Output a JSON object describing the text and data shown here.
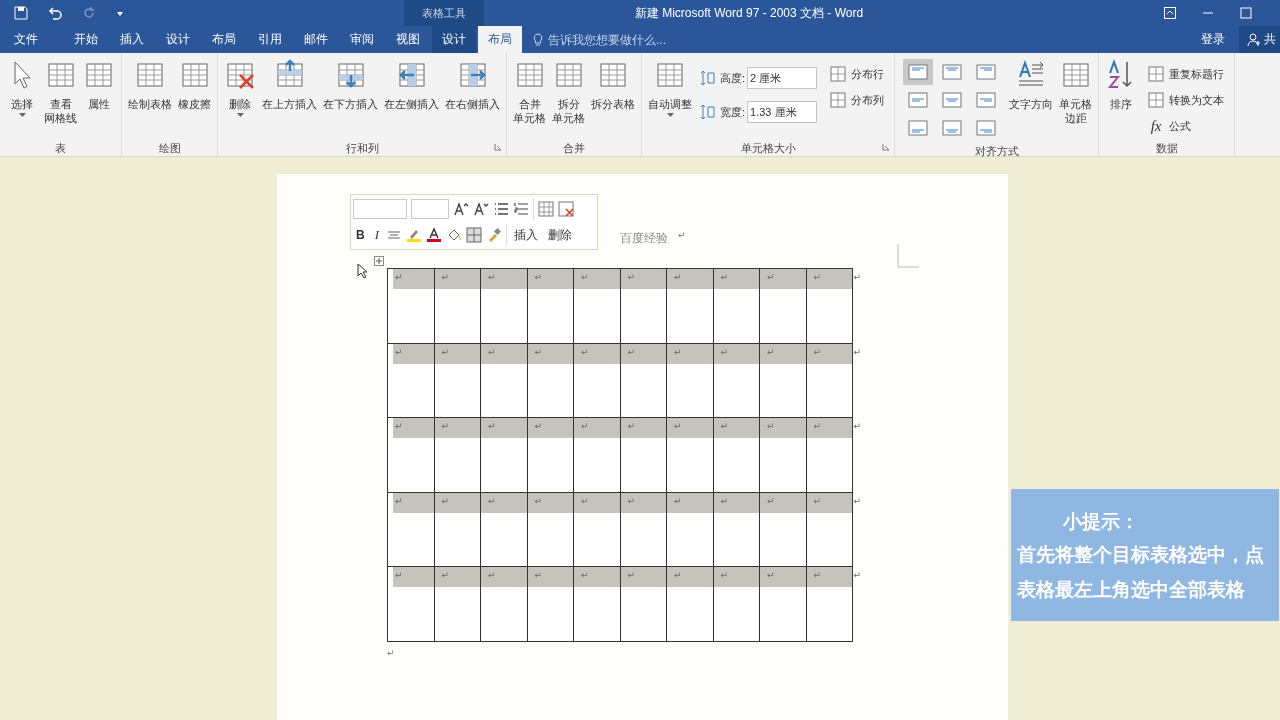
{
  "title_bar": {
    "context_label": "表格工具",
    "title": "新建 Microsoft Word 97 - 2003 文档 - Word"
  },
  "tabs": [
    {
      "label": "文件",
      "kind": "main",
      "selected": false
    },
    {
      "label": "开始",
      "kind": "main",
      "selected": false
    },
    {
      "label": "插入",
      "kind": "main",
      "selected": false
    },
    {
      "label": "设计",
      "kind": "main",
      "selected": false
    },
    {
      "label": "布局",
      "kind": "main",
      "selected": false
    },
    {
      "label": "引用",
      "kind": "main",
      "selected": false
    },
    {
      "label": "邮件",
      "kind": "main",
      "selected": false
    },
    {
      "label": "审阅",
      "kind": "main",
      "selected": false
    },
    {
      "label": "视图",
      "kind": "main",
      "selected": false
    },
    {
      "label": "设计",
      "kind": "context",
      "selected": false
    },
    {
      "label": "布局",
      "kind": "context",
      "selected": true
    }
  ],
  "tell_me": {
    "placeholder": "告诉我您想要做什么..."
  },
  "account": {
    "sign_in": "登录",
    "share": "共"
  },
  "ribbon": [
    {
      "label": "表",
      "launcher": false,
      "items": [
        {
          "kind": "pointer",
          "label": "选择",
          "caret": true
        },
        {
          "kind": "table",
          "lines": [
            "查看",
            "网格线"
          ],
          "caret": false
        },
        {
          "kind": "table",
          "label": "属性",
          "caret": false
        }
      ]
    },
    {
      "label": "绘图",
      "launcher": false,
      "items": [
        {
          "kind": "table",
          "label": "绘制表格",
          "caret": false
        },
        {
          "kind": "table",
          "label": "橡皮擦",
          "caret": false
        }
      ]
    },
    {
      "label": "行和列",
      "launcher": true,
      "items": [
        {
          "kind": "delete",
          "label": "删除",
          "caret": true
        },
        {
          "kind": "above",
          "label": "在上方插入",
          "caret": false
        },
        {
          "kind": "below",
          "label": "在下方插入",
          "caret": false
        },
        {
          "kind": "left",
          "label": "在左侧插入",
          "caret": false
        },
        {
          "kind": "right",
          "label": "在右侧插入",
          "caret": false
        }
      ]
    },
    {
      "label": "合并",
      "launcher": false,
      "items": [
        {
          "kind": "table",
          "lines": [
            "合并",
            "单元格"
          ],
          "caret": false
        },
        {
          "kind": "table",
          "lines": [
            "拆分",
            "单元格"
          ],
          "caret": false
        },
        {
          "kind": "table",
          "label": "拆分表格",
          "caret": false
        }
      ]
    },
    {
      "label": "单元格大小",
      "launcher": true,
      "items": [
        {
          "kind": "table",
          "label": "自动调整",
          "caret": true
        },
        {
          "kind": "field",
          "label": "高度:",
          "value": "2 厘米"
        },
        {
          "kind": "field",
          "label": "宽度:",
          "value": "1.33 厘米"
        },
        {
          "kind": "small",
          "label": "分布行"
        },
        {
          "kind": "small",
          "label": "分布列"
        }
      ]
    },
    {
      "label": "对齐方式",
      "launcher": false,
      "items": [
        {
          "kind": "align",
          "selected": true
        },
        {
          "kind": "align",
          "selected": false
        },
        {
          "kind": "align",
          "selected": false
        },
        {
          "kind": "align",
          "selected": false
        },
        {
          "kind": "align",
          "selected": false
        },
        {
          "kind": "align",
          "selected": false
        },
        {
          "kind": "align",
          "selected": false
        },
        {
          "kind": "align",
          "selected": false
        },
        {
          "kind": "align",
          "selected": false
        },
        {
          "kind": "direction",
          "label": "文字方向",
          "caret": false
        },
        {
          "kind": "table",
          "lines": [
            "单元格",
            "边距"
          ],
          "caret": false
        }
      ]
    },
    {
      "label": "数据",
      "launcher": false,
      "items": [
        {
          "kind": "sort",
          "label": "排序",
          "caret": false
        },
        {
          "kind": "small",
          "label": "重复标题行"
        },
        {
          "kind": "small",
          "label": "转换为文本"
        },
        {
          "kind": "formula",
          "glyph": "fx",
          "label": "公式"
        }
      ]
    }
  ],
  "mini_toolbar": {
    "bold": "B",
    "italic": "I",
    "buttons": [
      "插入",
      "删除"
    ]
  },
  "document": {
    "paragraph": "百度经验",
    "paragraph_mark": "↵",
    "end_mark": "↵"
  },
  "table": {
    "rows": [
      {
        "selected": true,
        "cells": [
          "↵",
          "↵",
          "↵",
          "↵",
          "↵",
          "↵",
          "↵",
          "↵",
          "↵",
          "↵"
        ],
        "end_mark": "↵"
      },
      {
        "selected": true,
        "cells": [
          "↵",
          "↵",
          "↵",
          "↵",
          "↵",
          "↵",
          "↵",
          "↵",
          "↵",
          "↵"
        ],
        "end_mark": "↵"
      },
      {
        "selected": true,
        "cells": [
          "↵",
          "↵",
          "↵",
          "↵",
          "↵",
          "↵",
          "↵",
          "↵",
          "↵",
          "↵"
        ],
        "end_mark": "↵"
      },
      {
        "selected": true,
        "cells": [
          "↵",
          "↵",
          "↵",
          "↵",
          "↵",
          "↵",
          "↵",
          "↵",
          "↵",
          "↵"
        ],
        "end_mark": "↵"
      },
      {
        "selected": true,
        "cells": [
          "↵",
          "↵",
          "↵",
          "↵",
          "↵",
          "↵",
          "↵",
          "↵",
          "↵",
          "↵"
        ],
        "end_mark": "↵"
      }
    ]
  },
  "tip": {
    "title": "小提示：",
    "text": "首先将整个目标表格选中，点表格最左上角选中全部表格"
  }
}
